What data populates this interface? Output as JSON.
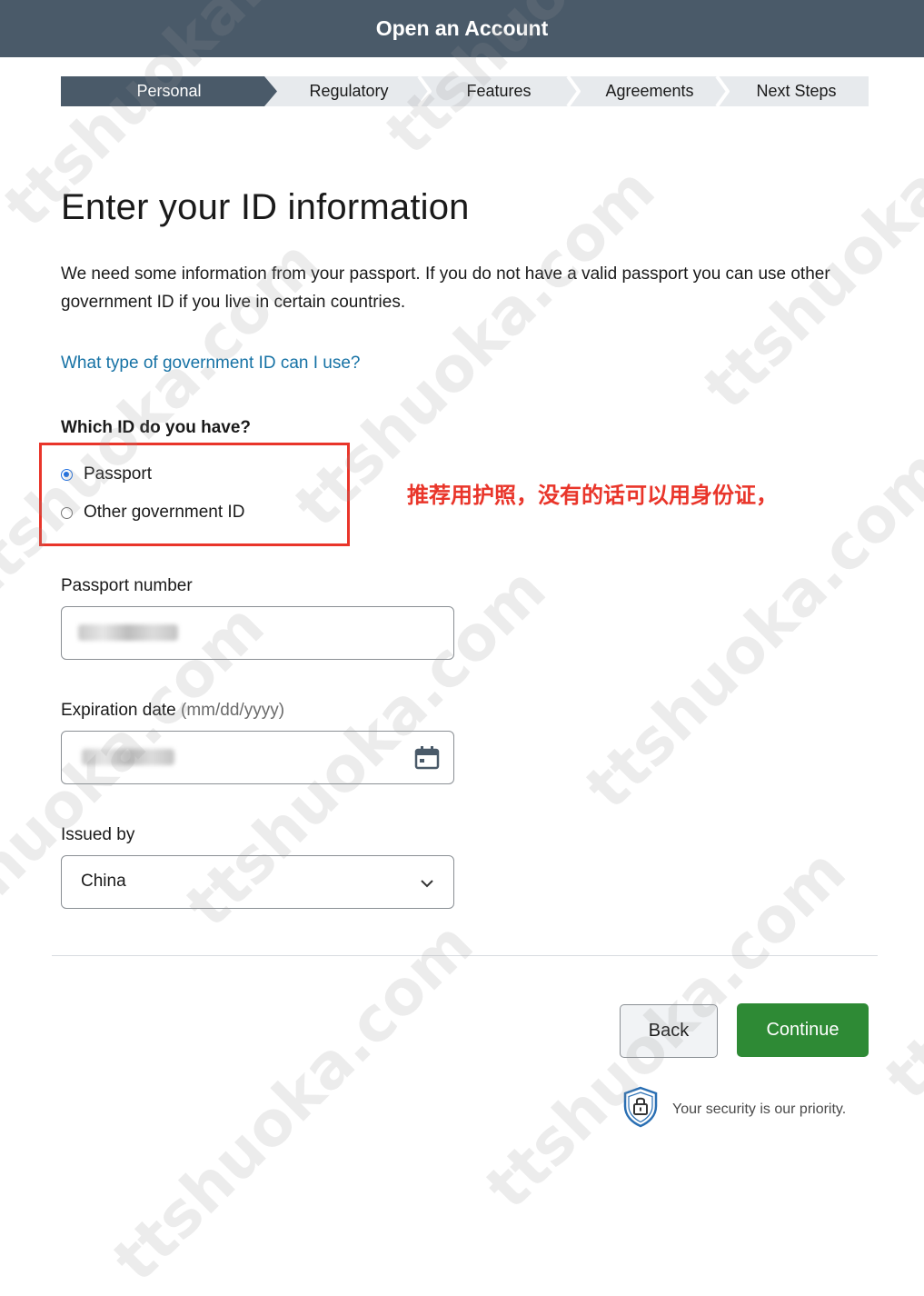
{
  "header": {
    "title": "Open an Account"
  },
  "steps": [
    {
      "label": "Personal",
      "active": true
    },
    {
      "label": "Regulatory",
      "active": false
    },
    {
      "label": "Features",
      "active": false
    },
    {
      "label": "Agreements",
      "active": false
    },
    {
      "label": "Next Steps",
      "active": false
    }
  ],
  "page": {
    "title": "Enter your ID information",
    "intro": "We need some information from your passport. If you do not have a valid passport you can use other government ID if you live in certain countries.",
    "help_link": "What type of government ID can I use?"
  },
  "id_question": {
    "legend": "Which ID do you have?",
    "options": [
      {
        "label": "Passport",
        "checked": true
      },
      {
        "label": "Other government ID",
        "checked": false
      }
    ]
  },
  "annotation": "推荐用护照，没有的话可以用身份证，",
  "fields": {
    "passport_number": {
      "label": "Passport number"
    },
    "expiration_date": {
      "label": "Expiration date",
      "hint": "(mm/dd/yyyy)"
    },
    "issued_by": {
      "label": "Issued by",
      "value": "China"
    }
  },
  "actions": {
    "back": "Back",
    "continue": "Continue"
  },
  "security": {
    "text": "Your security is our priority."
  },
  "watermark": {
    "text": "ttshuoka.com"
  },
  "colors": {
    "header_bg": "#4a5a69",
    "link": "#1672a5",
    "continue_bg": "#2e8a35",
    "annotation": "#e9352a",
    "radio_selected": "#1f6fe0"
  }
}
